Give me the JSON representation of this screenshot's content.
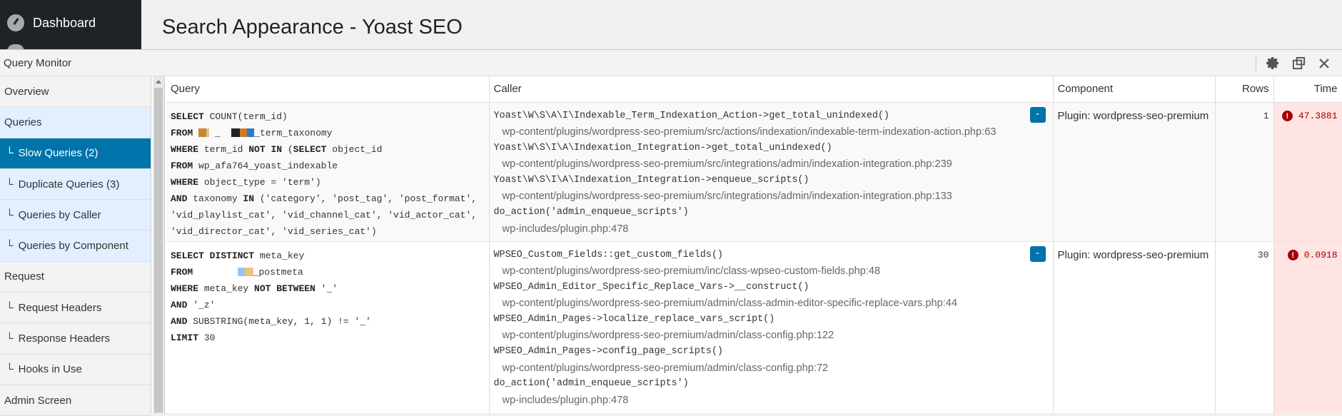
{
  "wp": {
    "sidebar_dashboard": "Dashboard",
    "page_title": "Search Appearance - Yoast SEO"
  },
  "qm": {
    "title": "Query Monitor",
    "controls": [
      "gear-icon",
      "popout-icon",
      "close-icon"
    ],
    "nav": [
      {
        "label": "Overview",
        "sub": false,
        "state": "normal"
      },
      {
        "label": "Queries",
        "sub": false,
        "state": "highlight"
      },
      {
        "label": "Slow Queries (2)",
        "sub": true,
        "state": "active"
      },
      {
        "label": "Duplicate Queries (3)",
        "sub": true,
        "state": "highlight"
      },
      {
        "label": "Queries by Caller",
        "sub": true,
        "state": "highlight"
      },
      {
        "label": "Queries by Component",
        "sub": true,
        "state": "highlight"
      },
      {
        "label": "Request",
        "sub": false,
        "state": "normal"
      },
      {
        "label": "Request Headers",
        "sub": true,
        "state": "normal"
      },
      {
        "label": "Response Headers",
        "sub": true,
        "state": "normal"
      },
      {
        "label": "Hooks in Use",
        "sub": true,
        "state": "normal"
      },
      {
        "label": "Admin Screen",
        "sub": false,
        "state": "normal"
      }
    ],
    "columns": {
      "query": "Query",
      "caller": "Caller",
      "component": "Component",
      "rows": "Rows",
      "time": "Time"
    },
    "toggle_label": "-",
    "rows": [
      {
        "component": "Plugin: wordpress-seo-premium",
        "rows": "1",
        "time": "47.3881",
        "callers": [
          {
            "fn": "Yoast\\W\\S\\A\\I\\Indexable_Term_Indexation_Action->get_total_unindexed()",
            "file": "wp-content/plugins/wordpress-seo-premium/src/actions/indexation/indexable-term-indexation-action.php:63"
          },
          {
            "fn": "Yoast\\W\\S\\I\\A\\Indexation_Integration->get_total_unindexed()",
            "file": "wp-content/plugins/wordpress-seo-premium/src/integrations/admin/indexation-integration.php:239"
          },
          {
            "fn": "Yoast\\W\\S\\I\\A\\Indexation_Integration->enqueue_scripts()",
            "file": "wp-content/plugins/wordpress-seo-premium/src/integrations/admin/indexation-integration.php:133"
          },
          {
            "fn": "do_action('admin_enqueue_scripts')",
            "file": "wp-includes/plugin.php:478"
          }
        ]
      },
      {
        "component": "Plugin: wordpress-seo-premium",
        "rows": "30",
        "time": "0.0918",
        "callers": [
          {
            "fn": "WPSEO_Custom_Fields::get_custom_fields()",
            "file": "wp-content/plugins/wordpress-seo-premium/inc/class-wpseo-custom-fields.php:48"
          },
          {
            "fn": "WPSEO_Admin_Editor_Specific_Replace_Vars->__construct()",
            "file": "wp-content/plugins/wordpress-seo-premium/admin/class-admin-editor-specific-replace-vars.php:44"
          },
          {
            "fn": "WPSEO_Admin_Pages->localize_replace_vars_script()",
            "file": "wp-content/plugins/wordpress-seo-premium/admin/class-config.php:122"
          },
          {
            "fn": "WPSEO_Admin_Pages->config_page_scripts()",
            "file": "wp-content/plugins/wordpress-seo-premium/admin/class-config.php:72"
          },
          {
            "fn": "do_action('admin_enqueue_scripts')",
            "file": "wp-includes/plugin.php:478"
          }
        ]
      }
    ],
    "sql1": {
      "l1_kw": "SELECT",
      "l1_rest": " COUNT(term_id)",
      "l2_kw": "FROM",
      "l2_rest": "_term_taxonomy",
      "l3_kw": "WHERE",
      "l3_a": " term_id ",
      "l3_kw2": "NOT IN",
      "l3_b": " (",
      "l3_kw3": "SELECT",
      "l3_c": " object_id",
      "l4_kw": "FROM",
      "l4_rest": " wp_afa764_yoast_indexable",
      "l5_kw": "WHERE",
      "l5_rest": " object_type = 'term')",
      "l6_kw": "AND",
      "l6_a": " taxonomy ",
      "l6_kw2": "IN",
      "l6_b": " ('category', 'post_tag', 'post_format', 'vid_playlist_cat', 'vid_channel_cat', 'vid_actor_cat', 'vid_director_cat', 'vid_series_cat')"
    },
    "sql2": {
      "l1_kw": "SELECT DISTINCT",
      "l1_rest": " meta_key",
      "l2_kw": "FROM",
      "l2_rest": "_postmeta",
      "l3_kw": "WHERE",
      "l3_a": " meta_key ",
      "l3_kw2": "NOT BETWEEN",
      "l3_b": " '_'",
      "l4_kw": "AND",
      "l4_rest": " '_z'",
      "l5_kw": "AND",
      "l5_rest": " SUBSTRING(meta_key, 1, 1) != '_'",
      "l6_kw": "LIMIT",
      "l6_rest": " 30"
    },
    "redaction_colors": [
      "#c8892a",
      "#1d2327",
      "#c97a2a",
      "#2a7acb",
      "#8fc8f0",
      "#f5c27a"
    ]
  }
}
